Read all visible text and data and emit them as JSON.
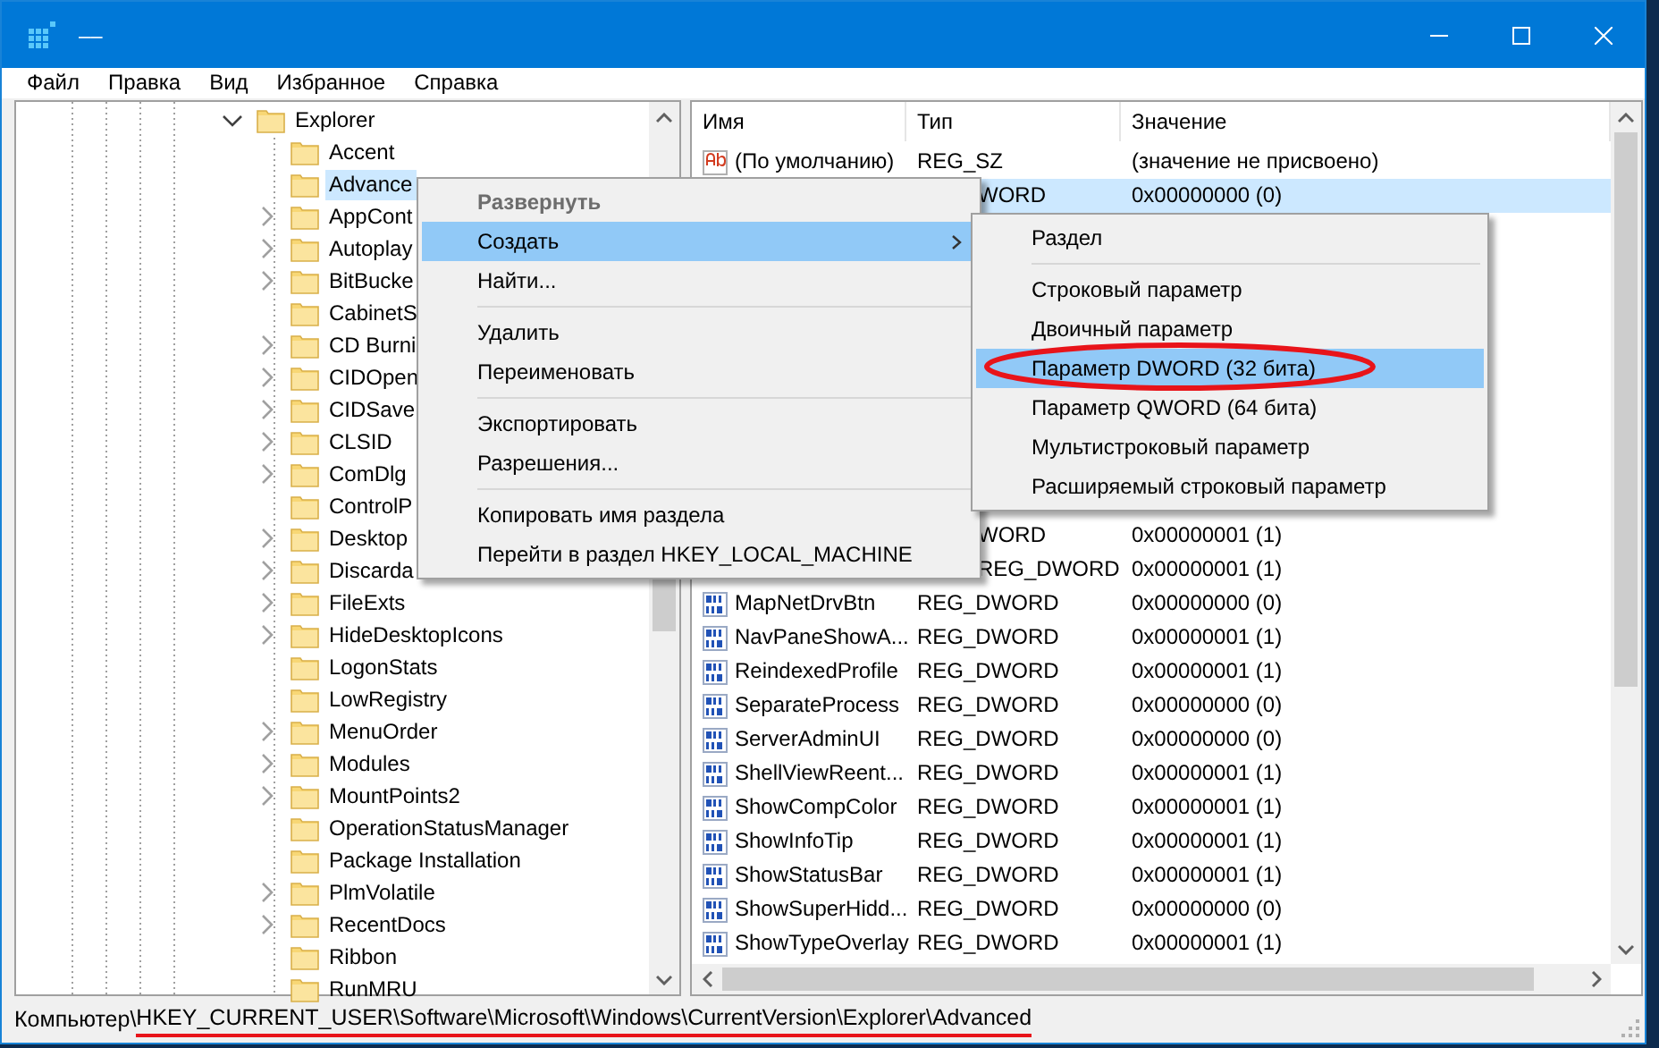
{
  "window": {
    "title": "––"
  },
  "menu_bar": [
    "Файл",
    "Правка",
    "Вид",
    "Избранное",
    "Справка"
  ],
  "tree": [
    {
      "label": "Explorer",
      "expanded": true,
      "children": [
        {
          "label": "Accent",
          "expandable": false,
          "selected": false
        },
        {
          "label": "Advance",
          "expandable": false,
          "selected": true
        },
        {
          "label": "AppCont",
          "expandable": true,
          "selected": false
        },
        {
          "label": "Autoplay",
          "expandable": true,
          "selected": false
        },
        {
          "label": "BitBucke",
          "expandable": true,
          "selected": false
        },
        {
          "label": "CabinetS",
          "expandable": false,
          "selected": false
        },
        {
          "label": "CD Burni",
          "expandable": true,
          "selected": false
        },
        {
          "label": "CIDOpen",
          "expandable": true,
          "selected": false
        },
        {
          "label": "CIDSave",
          "expandable": true,
          "selected": false
        },
        {
          "label": "CLSID",
          "expandable": true,
          "selected": false
        },
        {
          "label": "ComDlg",
          "expandable": true,
          "selected": false
        },
        {
          "label": "ControlP",
          "expandable": false,
          "selected": false
        },
        {
          "label": "Desktop",
          "expandable": true,
          "selected": false
        },
        {
          "label": "Discarda",
          "expandable": true,
          "selected": false
        },
        {
          "label": "FileExts",
          "expandable": true,
          "selected": false
        },
        {
          "label": "HideDesktopIcons",
          "expandable": true,
          "selected": false
        },
        {
          "label": "LogonStats",
          "expandable": false,
          "selected": false
        },
        {
          "label": "LowRegistry",
          "expandable": false,
          "selected": false
        },
        {
          "label": "MenuOrder",
          "expandable": true,
          "selected": false
        },
        {
          "label": "Modules",
          "expandable": true,
          "selected": false
        },
        {
          "label": "MountPoints2",
          "expandable": true,
          "selected": false
        },
        {
          "label": "OperationStatusManager",
          "expandable": false,
          "selected": false
        },
        {
          "label": "Package Installation",
          "expandable": false,
          "selected": false
        },
        {
          "label": "PlmVolatile",
          "expandable": true,
          "selected": false
        },
        {
          "label": "RecentDocs",
          "expandable": true,
          "selected": false
        },
        {
          "label": "Ribbon",
          "expandable": false,
          "selected": false
        },
        {
          "label": "RunMRU",
          "expandable": false,
          "selected": false
        }
      ]
    }
  ],
  "table": {
    "columns": [
      "Имя",
      "Тип",
      "Значение"
    ],
    "rows": [
      {
        "kind": "string",
        "name": "(По умолчанию)",
        "type": "REG_SZ",
        "value": "(значение не присвоено)",
        "selected": false
      },
      {
        "type": "WORD",
        "value": "0x00000000 (0)",
        "selected": true
      },
      {
        "type": "WORD",
        "value": "0x00000001 (1)",
        "selected": false
      },
      {
        "type": "REG_DWORD",
        "value": "0x00000001 (1)",
        "selected": false
      },
      {
        "kind": "dword",
        "name": "MapNetDrvBtn",
        "type": "REG_DWORD",
        "value": "0x00000000 (0)",
        "selected": false
      },
      {
        "kind": "dword",
        "name": "NavPaneShowA...",
        "type": "REG_DWORD",
        "value": "0x00000001 (1)",
        "selected": false
      },
      {
        "kind": "dword",
        "name": "ReindexedProfile",
        "type": "REG_DWORD",
        "value": "0x00000001 (1)",
        "selected": false
      },
      {
        "kind": "dword",
        "name": "SeparateProcess",
        "type": "REG_DWORD",
        "value": "0x00000000 (0)",
        "selected": false
      },
      {
        "kind": "dword",
        "name": "ServerAdminUI",
        "type": "REG_DWORD",
        "value": "0x00000000 (0)",
        "selected": false
      },
      {
        "kind": "dword",
        "name": "ShellViewReent...",
        "type": "REG_DWORD",
        "value": "0x00000001 (1)",
        "selected": false
      },
      {
        "kind": "dword",
        "name": "ShowCompColor",
        "type": "REG_DWORD",
        "value": "0x00000001 (1)",
        "selected": false
      },
      {
        "kind": "dword",
        "name": "ShowInfoTip",
        "type": "REG_DWORD",
        "value": "0x00000001 (1)",
        "selected": false
      },
      {
        "kind": "dword",
        "name": "ShowStatusBar",
        "type": "REG_DWORD",
        "value": "0x00000001 (1)",
        "selected": false
      },
      {
        "kind": "dword",
        "name": "ShowSuperHidd...",
        "type": "REG_DWORD",
        "value": "0x00000000 (0)",
        "selected": false
      },
      {
        "kind": "dword",
        "name": "ShowTypeOverlay",
        "type": "REG_DWORD",
        "value": "0x00000001 (1)",
        "selected": false
      }
    ]
  },
  "context_menu": [
    {
      "kind": "item",
      "label": "Развернуть",
      "disabled": true,
      "bold": true,
      "selected": false
    },
    {
      "kind": "submenu",
      "label": "Создать",
      "disabled": false,
      "selected": true
    },
    {
      "kind": "item",
      "label": "Найти...",
      "disabled": false,
      "selected": false
    },
    {
      "kind": "separator"
    },
    {
      "kind": "item",
      "label": "Удалить",
      "disabled": false,
      "selected": false
    },
    {
      "kind": "item",
      "label": "Переименовать",
      "disabled": false,
      "selected": false
    },
    {
      "kind": "separator"
    },
    {
      "kind": "item",
      "label": "Экспортировать",
      "disabled": false,
      "selected": false
    },
    {
      "kind": "item",
      "label": "Разрешения...",
      "disabled": false,
      "selected": false
    },
    {
      "kind": "separator"
    },
    {
      "kind": "item",
      "label": "Копировать имя раздела",
      "disabled": false,
      "selected": false
    },
    {
      "kind": "item",
      "label": "Перейти в раздел HKEY_LOCAL_MACHINE",
      "disabled": false,
      "selected": false
    }
  ],
  "submenu": [
    {
      "kind": "item",
      "label": "Раздел",
      "selected": false
    },
    {
      "kind": "separator"
    },
    {
      "kind": "item",
      "label": "Строковый параметр",
      "selected": false
    },
    {
      "kind": "item",
      "label": "Двоичный параметр",
      "selected": false
    },
    {
      "kind": "item",
      "label": "Параметр DWORD (32 бита)",
      "selected": true,
      "circled": true
    },
    {
      "kind": "item",
      "label": "Параметр QWORD (64 бита)",
      "selected": false
    },
    {
      "kind": "item",
      "label": "Мультистроковый параметр",
      "selected": false
    },
    {
      "kind": "item",
      "label": "Расширяемый строковый параметр",
      "selected": false
    }
  ],
  "status_bar": {
    "root": "Компьютер\\",
    "path": "HKEY_CURRENT_USER\\Software\\Microsoft\\Windows\\CurrentVersion\\Explorer\\Advanced",
    "path_underlined": true
  }
}
